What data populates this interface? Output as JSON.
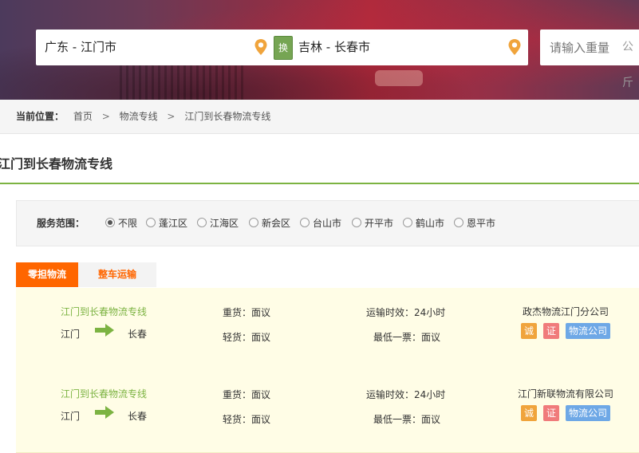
{
  "search": {
    "origin": "广东 - 江门市",
    "swap_label": "换",
    "destination": "吉林 - 长春市",
    "weight_placeholder": "请输入重量",
    "weight_unit": "公斤"
  },
  "breadcrumb": {
    "label": "当前位置：",
    "items": [
      "首页",
      "物流专线",
      "江门到长春物流专线"
    ],
    "separator": ">"
  },
  "page_title": "江门到长春物流专线",
  "filter": {
    "label": "服务范围：",
    "selected": "不限",
    "options": [
      "不限",
      "蓬江区",
      "江海区",
      "新会区",
      "台山市",
      "开平市",
      "鹤山市",
      "恩平市"
    ]
  },
  "tabs": [
    {
      "label": "零担物流",
      "active": true
    },
    {
      "label": "整车运输",
      "active": false
    }
  ],
  "colors": {
    "accent_orange": "#ff6600",
    "accent_green": "#7cb342",
    "listing_bg": "#fffde6"
  },
  "icons": {
    "location": "location-pin-icon",
    "arrow": "arrow-right-icon"
  },
  "listings": [
    {
      "route": "江门到长春物流专线",
      "origin": "江门",
      "destination": "长春",
      "heavy": "重货：面议",
      "light": "轻货：面议",
      "time": "运输时效：24小时",
      "min": "最低一票：面议",
      "company": "政杰物流江门分公司",
      "badges": [
        "诚",
        "证",
        "物流公司"
      ]
    },
    {
      "route": "江门到长春物流专线",
      "origin": "江门",
      "destination": "长春",
      "heavy": "重货：面议",
      "light": "轻货：面议",
      "time": "运输时效：24小时",
      "min": "最低一票：面议",
      "company": "江门新联物流有限公司",
      "badges": [
        "诚",
        "证",
        "物流公司"
      ]
    }
  ]
}
